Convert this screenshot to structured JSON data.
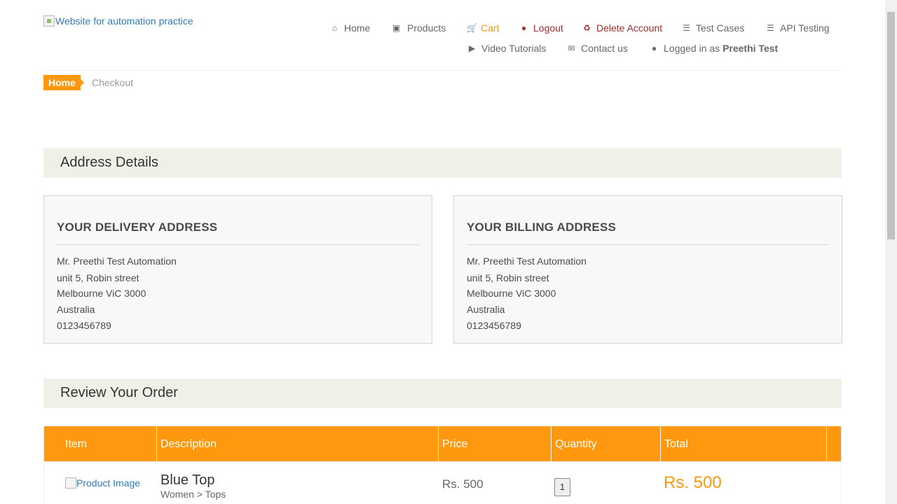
{
  "header": {
    "logo_alt": "Website for automation practice",
    "nav": [
      {
        "label": "Home",
        "icon": "home-icon"
      },
      {
        "label": "Products",
        "icon": "products-icon"
      },
      {
        "label": "Cart",
        "icon": "cart-icon"
      },
      {
        "label": "Logout",
        "icon": "lock-icon"
      },
      {
        "label": "Delete Account",
        "icon": "trash-icon"
      },
      {
        "label": "Test Cases",
        "icon": "list-icon"
      },
      {
        "label": "API Testing",
        "icon": "list-icon"
      },
      {
        "label": "Video Tutorials",
        "icon": "youtube-icon"
      },
      {
        "label": "Contact us",
        "icon": "envelope-icon"
      }
    ],
    "logged_in_prefix": "Logged in as",
    "logged_in_user": "Preethi Test"
  },
  "breadcrumb": {
    "home": "Home",
    "current": "Checkout"
  },
  "address_section": {
    "title": "Address Details",
    "delivery": {
      "heading": "YOUR DELIVERY ADDRESS",
      "lines": [
        "Mr. Preethi Test Automation",
        "unit 5, Robin street",
        "Melbourne ViC 3000",
        "Australia",
        "0123456789"
      ]
    },
    "billing": {
      "heading": "YOUR BILLING ADDRESS",
      "lines": [
        "Mr. Preethi Test Automation",
        "unit 5, Robin street",
        "Melbourne ViC 3000",
        "Australia",
        "0123456789"
      ]
    }
  },
  "order_section": {
    "title": "Review Your Order",
    "columns": [
      "Item",
      "Description",
      "Price",
      "Quantity",
      "Total"
    ],
    "rows": [
      {
        "image_alt": "Product Image",
        "name": "Blue Top",
        "category": "Women > Tops",
        "price": "Rs. 500",
        "quantity": "1",
        "total": "Rs. 500"
      }
    ]
  },
  "colors": {
    "accent": "#FE980F",
    "danger": "#A32D2D",
    "panel": "#F0F0E9"
  }
}
